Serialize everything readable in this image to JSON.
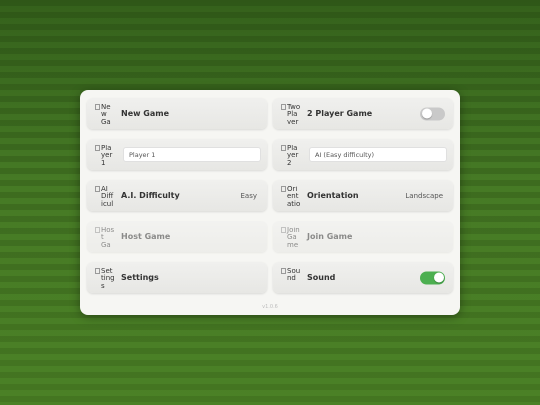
{
  "menu": {
    "new_game": {
      "alt": "New Game",
      "label": "New Game"
    },
    "two_player": {
      "alt": "Two Player",
      "label": "2 Player Game",
      "enabled": false
    },
    "player1": {
      "alt": "Player 1",
      "value": "Player 1"
    },
    "player2": {
      "alt": "Player 2",
      "value": "AI (Easy difficulty)"
    },
    "ai_difficulty": {
      "alt": "AI Difficulty",
      "label": "A.I. Difficulty",
      "value": "Easy"
    },
    "orientation": {
      "alt": "Orientation",
      "label": "Orientation",
      "value": "Landscape"
    },
    "host_game": {
      "alt": "Host Game",
      "label": "Host Game"
    },
    "join_game": {
      "alt": "Join Game",
      "label": "Join Game"
    },
    "settings": {
      "alt": "Settings",
      "label": "Settings"
    },
    "sound": {
      "alt": "Sound",
      "label": "Sound",
      "enabled": true
    }
  },
  "version": "v1.0.6",
  "colors": {
    "toggle_on": "#4caf50",
    "toggle_off": "#c9c9c9",
    "panel": "#f6f6f3"
  },
  "icons": {
    "new_game": "new-game-icon",
    "two_player": "two-player-icon",
    "player1": "player-1-icon",
    "player2": "player-2-icon",
    "ai_difficulty": "ai-difficulty-icon",
    "orientation": "orientation-icon",
    "host_game": "host-game-icon",
    "join_game": "join-game-icon",
    "settings": "settings-icon",
    "sound": "sound-icon"
  }
}
